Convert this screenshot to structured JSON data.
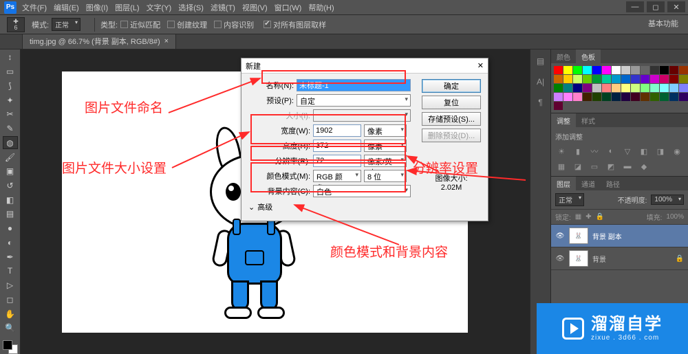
{
  "menubar": {
    "logo": "Ps",
    "items": [
      "文件(F)",
      "编辑(E)",
      "图像(I)",
      "图层(L)",
      "文字(Y)",
      "选择(S)",
      "滤镜(T)",
      "视图(V)",
      "窗口(W)",
      "帮助(H)"
    ]
  },
  "optionsbar": {
    "tool_badge_top": "✚",
    "tool_badge_bot": "6",
    "mode_lbl": "模式:",
    "mode_val": "正常",
    "type_lbl": "类型:",
    "o1": "近似匹配",
    "o2": "创建纹理",
    "o3": "内容识别",
    "sample_lbl": "对所有图层取样",
    "workspace": "基本功能"
  },
  "doctab": {
    "label": "timg.jpg @ 66.7% (背景 副本, RGB/8#)"
  },
  "annotations": {
    "a1": "图片文件命名",
    "a2": "图片文件大小设置",
    "a3": "分辨率设置",
    "a4": "颜色模式和背景内容"
  },
  "dialog": {
    "title": "新建",
    "name_lbl": "名称(N):",
    "name_val": "未标题-1",
    "preset_lbl": "预设(P):",
    "preset_val": "自定",
    "size_lbl": "大小(I):",
    "width_lbl": "宽度(W):",
    "width_val": "1902",
    "width_unit": "像素",
    "height_lbl": "高度(H):",
    "height_val": "372",
    "height_unit": "像素",
    "res_lbl": "分辨率(R):",
    "res_val": "72",
    "res_unit": "像素/英寸",
    "mode_lbl": "颜色模式(M):",
    "mode_val": "RGB 颜色",
    "mode_bits": "8 位",
    "bg_lbl": "背景内容(C):",
    "bg_val": "白色",
    "adv_lbl": "高级",
    "ok": "确定",
    "reset": "复位",
    "save_preset": "存储预设(S)...",
    "del_preset": "删除预设(D)...",
    "imgsize_lbl": "图像大小:",
    "imgsize_val": "2.02M"
  },
  "panels": {
    "color_tab": "颜色",
    "swatches_tab": "色板",
    "adjust_tab": "调整",
    "styles_tab": "样式",
    "adjust_title": "添加调整",
    "layers_tab": "图层",
    "channels_tab": "通道",
    "paths_tab": "路径",
    "blend": "正常",
    "opacity_lbl": "不透明度:",
    "opacity_val": "100%",
    "lock_lbl": "锁定:",
    "fill_lbl": "填充:",
    "fill_val": "100%",
    "layer1": "背景 副本",
    "layer2": "背景"
  },
  "watermark": {
    "big": "溜溜自学",
    "small": "zixue . 3d66 . com"
  },
  "swatch_colors": [
    "#ff0000",
    "#ffff00",
    "#00ff00",
    "#00ffff",
    "#0000ff",
    "#ff00ff",
    "#ffffff",
    "#cccccc",
    "#999999",
    "#666666",
    "#333333",
    "#000000",
    "#660000",
    "#993300",
    "#cc6600",
    "#ffcc00",
    "#ccff66",
    "#66cc00",
    "#009933",
    "#00cc99",
    "#0099cc",
    "#0066cc",
    "#3333cc",
    "#6600cc",
    "#cc00cc",
    "#cc0066",
    "#800000",
    "#808000",
    "#008000",
    "#008080",
    "#000080",
    "#800080",
    "#c0c0c0",
    "#ff8080",
    "#ffcc80",
    "#ffff80",
    "#ccff80",
    "#80ff80",
    "#80ffcc",
    "#80ffff",
    "#80ccff",
    "#8080ff",
    "#cc80ff",
    "#ff80ff",
    "#ff80cc",
    "#402000",
    "#204000",
    "#004020",
    "#002040",
    "#200040",
    "#400020",
    "#603000",
    "#306000",
    "#006030",
    "#003060",
    "#300060",
    "#600030"
  ]
}
